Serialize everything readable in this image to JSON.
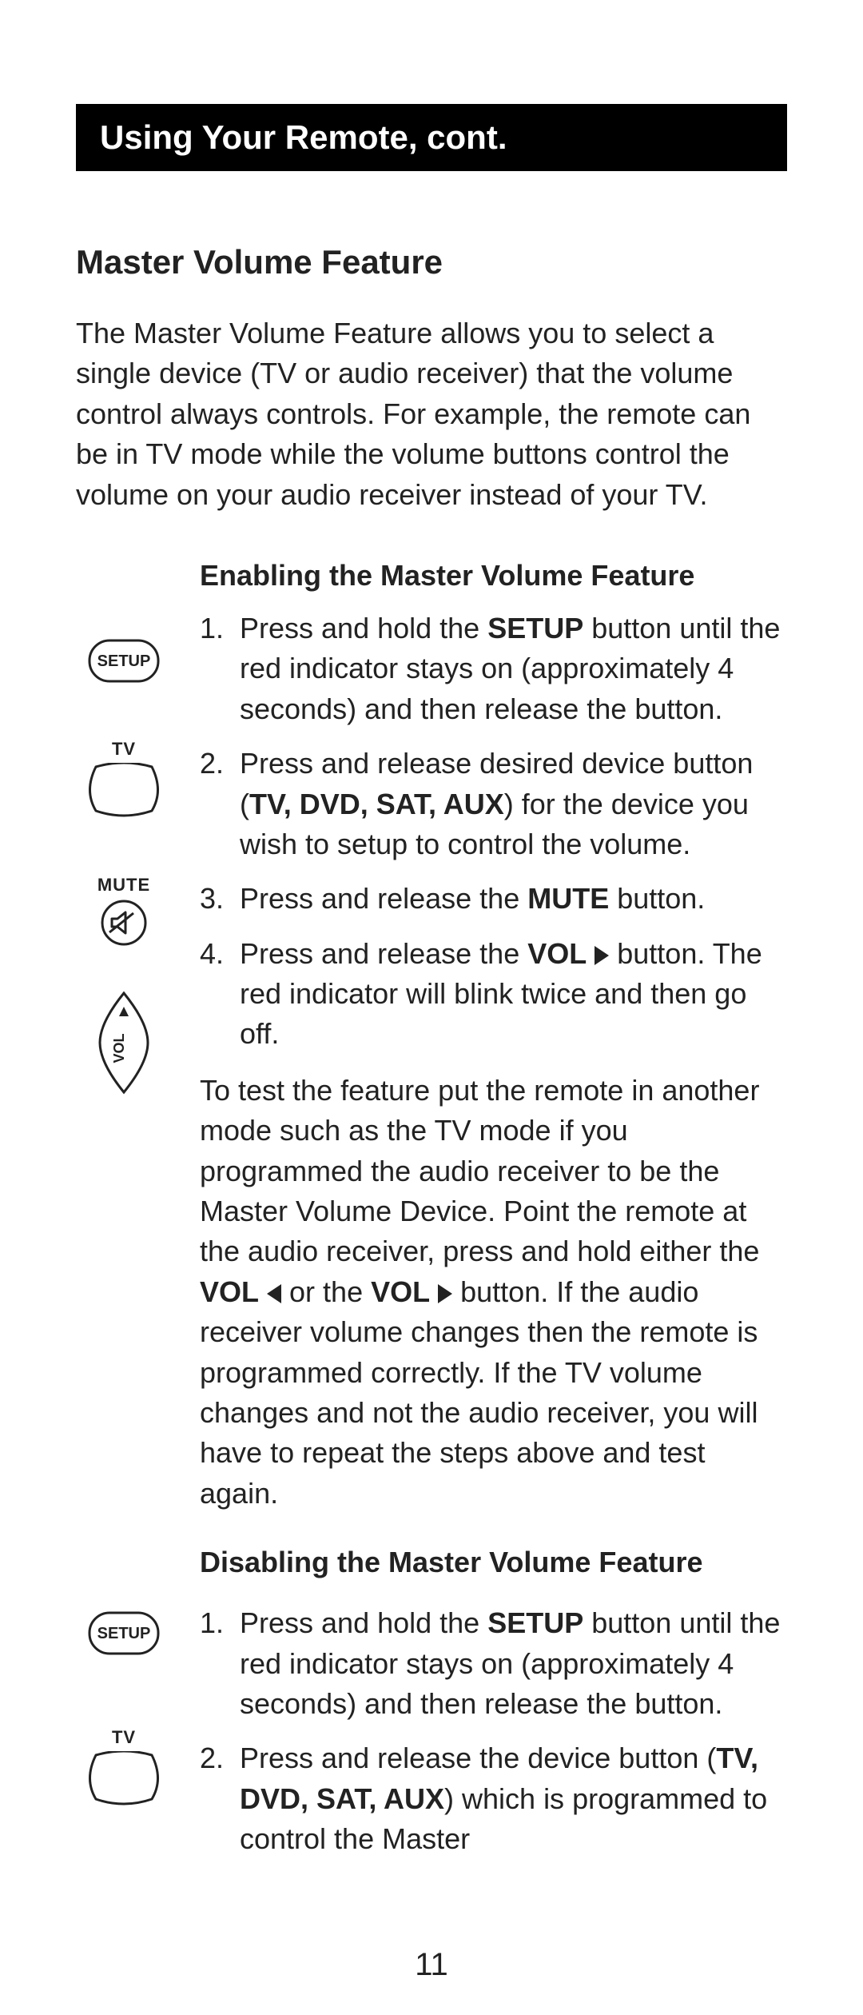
{
  "header": "Using Your Remote, cont.",
  "section_heading": "Master Volume Feature",
  "intro": "The Master Volume Feature allows you to select a single device (TV or audio receiver) that the volume control always controls. For example, the remote can be in TV mode while the volume buttons control the volume on your audio receiver instead of your TV.",
  "enable": {
    "heading": "Enabling the Master Volume Feature",
    "step1_a": "Press and hold the ",
    "step1_b": "SETUP",
    "step1_c": " button until the red indicator stays on (approximately 4 seconds) and then release the button.",
    "step2_a": "Press and release desired device button (",
    "step2_b": "TV, DVD, SAT, AUX",
    "step2_c": ") for the device you wish to setup to control the volume.",
    "step3_a": "Press and release the ",
    "step3_b": "MUTE",
    "step3_c": " button.",
    "step4_a": "Press and release the ",
    "step4_b": "VOL",
    "step4_c": " button. The red indicator will blink twice and then go off.",
    "test_a": "To test the feature put the remote in another mode such as the TV mode if you programmed the audio receiver to be the Master Volume Device. Point the remote at the audio receiver, press and hold either the ",
    "test_b": "VOL",
    "test_c": " or the ",
    "test_d": "VOL",
    "test_e": " button. If the audio receiver volume changes then the remote is programmed correctly. If the TV volume changes and not the audio receiver, you will have to repeat the steps above and test again."
  },
  "disable": {
    "heading": "Disabling the Master Volume Feature",
    "step1_a": "Press and hold the ",
    "step1_b": "SETUP",
    "step1_c": " button until the red indicator stays on (approximately 4 seconds) and then release the button.",
    "step2_a": "Press and release the device button (",
    "step2_b": "TV, DVD, SAT, AUX",
    "step2_c": ") which is programmed to control the Master"
  },
  "icons": {
    "setup": "SETUP",
    "tv": "TV",
    "mute": "MUTE",
    "vol": "VOL"
  },
  "page_number": "11"
}
